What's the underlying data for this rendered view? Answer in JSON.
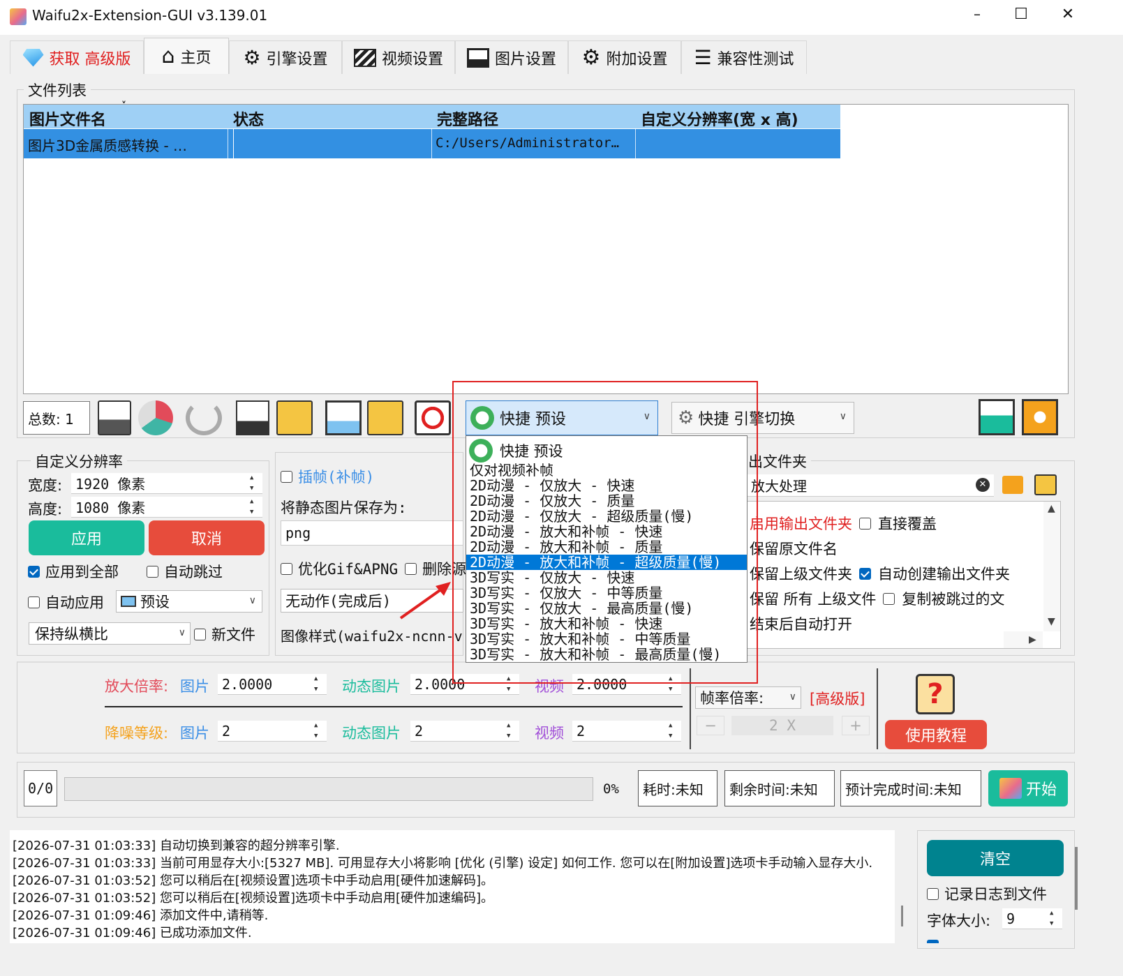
{
  "window": {
    "title": "Waifu2x-Extension-GUI v3.139.01",
    "controls": {
      "minimize": "–",
      "maximize": "☐",
      "close": "✕"
    }
  },
  "tabs": [
    {
      "label": "获取 高级版",
      "icon": "diamond-icon"
    },
    {
      "label": "主页",
      "icon": "home-icon"
    },
    {
      "label": "引擎设置",
      "icon": "engine-icon"
    },
    {
      "label": "视频设置",
      "icon": "clapper-icon"
    },
    {
      "label": "图片设置",
      "icon": "picture-icon"
    },
    {
      "label": "附加设置",
      "icon": "gear-icon"
    },
    {
      "label": "兼容性测试",
      "icon": "checklist-icon"
    }
  ],
  "file_list": {
    "group_label": "文件列表",
    "columns": [
      "图片文件名",
      "状态",
      "完整路径",
      "自定义分辨率(宽 x 高)"
    ],
    "rows": [
      {
        "name": "图片3D金属质感转换 - …",
        "status": "",
        "path": "C:/Users/Administrator…",
        "resolution": ""
      }
    ]
  },
  "toolbar": {
    "total": "总数: 1",
    "preset_combo": "快捷 预设",
    "engine_combo": "快捷 引擎切换"
  },
  "preset_dropdown": {
    "header": "快捷 预设",
    "items": [
      "仅对视频补帧",
      "2D动漫 - 仅放大 - 快速",
      "2D动漫 - 仅放大 - 质量",
      "2D动漫 - 仅放大 - 超级质量(慢)",
      "2D动漫 - 放大和补帧 - 快速",
      "2D动漫 - 放大和补帧 - 质量",
      "2D动漫 - 放大和补帧 - 超级质量(慢)",
      "3D写实 - 仅放大 - 快速",
      "3D写实 - 仅放大 - 中等质量",
      "3D写实 - 仅放大 - 最高质量(慢)",
      "3D写实 - 放大和补帧 - 快速",
      "3D写实 - 放大和补帧 - 中等质量",
      "3D写实 - 放大和补帧 - 最高质量(慢)"
    ],
    "selected_index": 6
  },
  "custom_res": {
    "group_label": "自定义分辨率",
    "width_label": "宽度:",
    "width_value": "1920 像素",
    "height_label": "高度:",
    "height_value": "1080 像素",
    "apply": "应用",
    "cancel": "取消",
    "apply_all": "应用到全部",
    "auto_skip": "自动跳过",
    "auto_apply": "自动应用",
    "preset": "预设",
    "keep_ratio": "保持纵横比",
    "new_file": "新文件"
  },
  "mid_panel": {
    "interp": "插帧(补帧)",
    "save_as_label": "将静态图片保存为:",
    "format": "png",
    "optimize_gif": "优化Gif&APNG",
    "delete_src": "删除源",
    "after_action": "无动作(完成后)",
    "image_style": "图像样式(waifu2x-ncnn-v"
  },
  "output_panel": {
    "group_label": "出文件夹",
    "path": "放大处理",
    "enable_output": "启用输出文件夹",
    "overwrite": "直接覆盖",
    "keep_name": "保留原文件名",
    "keep_parent": "保留上级文件夹",
    "auto_create": "自动创建输出文件夹",
    "keep_all_parent": "保留 所有 上级文件",
    "copy_skipped": "复制被跳过的文",
    "open_after": "结束后自动打开"
  },
  "scale": {
    "scale_label": "放大倍率:",
    "denoise_label": "降噪等级:",
    "img": "图片",
    "gif": "动态图片",
    "video": "视频",
    "scale_img": "2.0000",
    "scale_gif": "2.0000",
    "scale_video": "2.0000",
    "denoise_img": "2",
    "denoise_gif": "2",
    "denoise_video": "2",
    "fps_label": "帧率倍率:",
    "premium": "[高级版]",
    "minus": "−",
    "fps_value": "2 X",
    "plus": "+",
    "tutorial": "使用教程"
  },
  "progress": {
    "count": "0/0",
    "percent": "0%",
    "percent_value": 0,
    "elapsed": "耗时:未知",
    "remaining": "剩余时间:未知",
    "eta": "预计完成时间:未知",
    "start": "开始"
  },
  "log": {
    "lines": [
      "[2026-07-31 01:03:33] 自动切换到兼容的超分辨率引擎.",
      "[2026-07-31 01:03:33] 当前可用显存大小:[5327 MB]. 可用显存大小将影响 [优化 (引擎) 设定] 如何工作. 您可以在[附加设置]选项卡手动输入显存大小.",
      "[2026-07-31 01:03:52] 您可以稍后在[视频设置]选项卡中手动启用[硬件加速解码]。",
      "[2026-07-31 01:03:52] 您可以稍后在[视频设置]选项卡中手动启用[硬件加速编码]。",
      "[2026-07-31 01:09:46] 添加文件中,请稍等.",
      "[2026-07-31 01:09:46] 已成功添加文件."
    ],
    "clear": "清空",
    "log_to_file": "记录日志到文件",
    "font_size_label": "字体大小:",
    "font_size": "9"
  },
  "colors": {
    "accent_blue": "#3a8ee6",
    "selection": "#0078d7",
    "green_button": "#1abc9c",
    "red_button": "#e74c3c",
    "teal_button": "#00838f",
    "highlight_red": "#e02020"
  }
}
